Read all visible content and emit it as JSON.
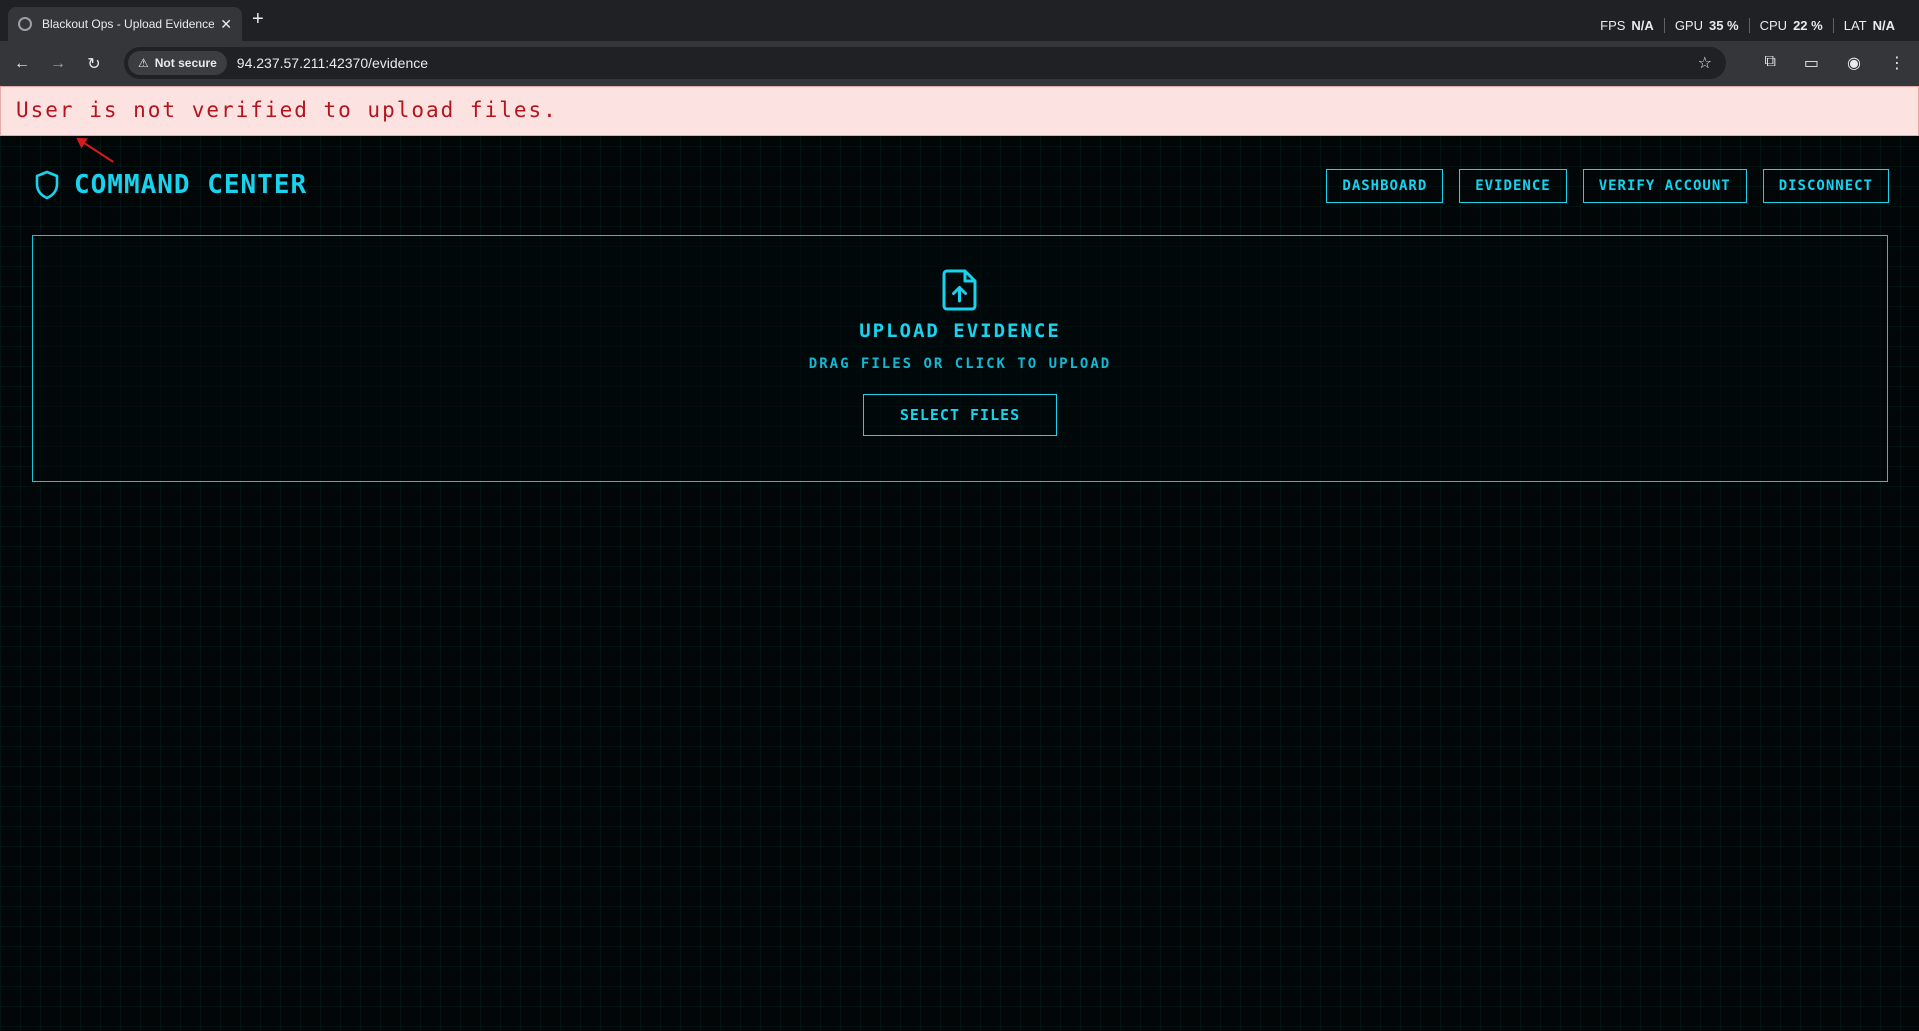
{
  "browser": {
    "tab_title": "Blackout Ops - Upload Evidence",
    "new_tab": "+",
    "perf": [
      {
        "label": "FPS",
        "value": "N/A"
      },
      {
        "label": "GPU",
        "value": "35 %"
      },
      {
        "label": "CPU",
        "value": "22 %"
      },
      {
        "label": "LAT",
        "value": "N/A"
      }
    ],
    "security_label": "Not secure",
    "url": "94.237.57.211:42370/evidence"
  },
  "alert": {
    "message": "User is not verified to upload files."
  },
  "header": {
    "brand": "COMMAND CENTER",
    "nav": [
      "DASHBOARD",
      "EVIDENCE",
      "VERIFY ACCOUNT",
      "DISCONNECT"
    ]
  },
  "upload": {
    "title": "UPLOAD EVIDENCE",
    "subtitle": "DRAG FILES OR CLICK TO UPLOAD",
    "button": "SELECT FILES"
  },
  "colors": {
    "accent": "#19d3ee",
    "error_bg": "#fde2e2",
    "error_text": "#b3141d"
  }
}
